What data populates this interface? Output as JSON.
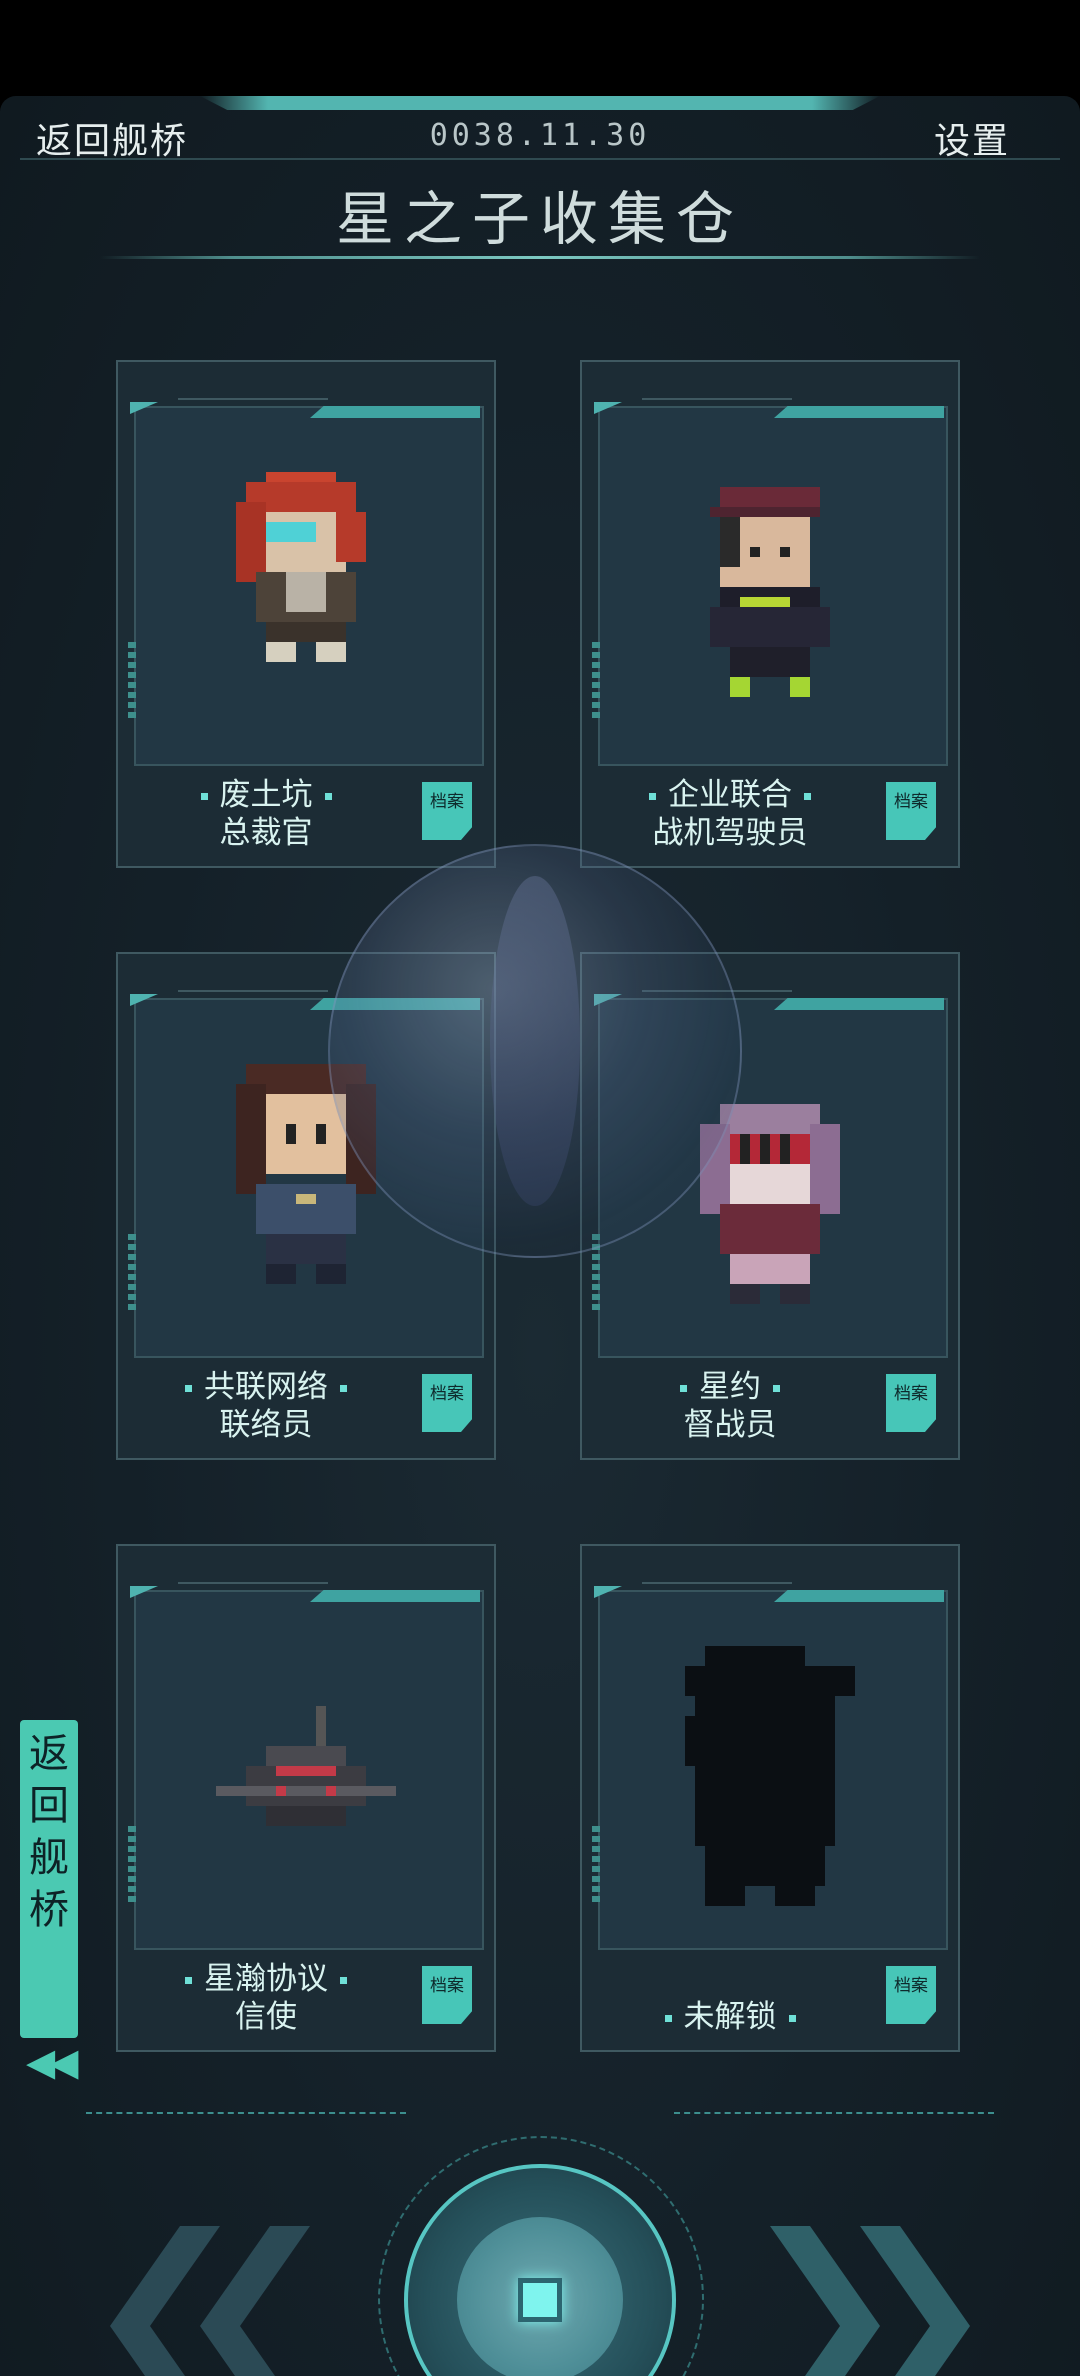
{
  "header": {
    "back_label": "返回舰桥",
    "date": "0038.11.30",
    "settings_label": "设置",
    "title": "星之子收集仓"
  },
  "cards": [
    {
      "line1": "废土坑",
      "line2": "总裁官",
      "badge": "档案"
    },
    {
      "line1": "企业联合",
      "line2": "战机驾驶员",
      "badge": "档案"
    },
    {
      "line1": "共联网络",
      "line2": "联络员",
      "badge": "档案"
    },
    {
      "line1": "星约",
      "line2": "督战员",
      "badge": "档案"
    },
    {
      "line1": "星瀚协议",
      "line2": "信使",
      "badge": "档案"
    },
    {
      "line1": "未解锁",
      "line2": "",
      "badge": "档案"
    }
  ],
  "side": {
    "back_label": "返回舰桥",
    "arrows": "◀◀"
  },
  "colors": {
    "accent": "#4bc9b2",
    "label": "#d9f3f0",
    "background": "#142028"
  }
}
